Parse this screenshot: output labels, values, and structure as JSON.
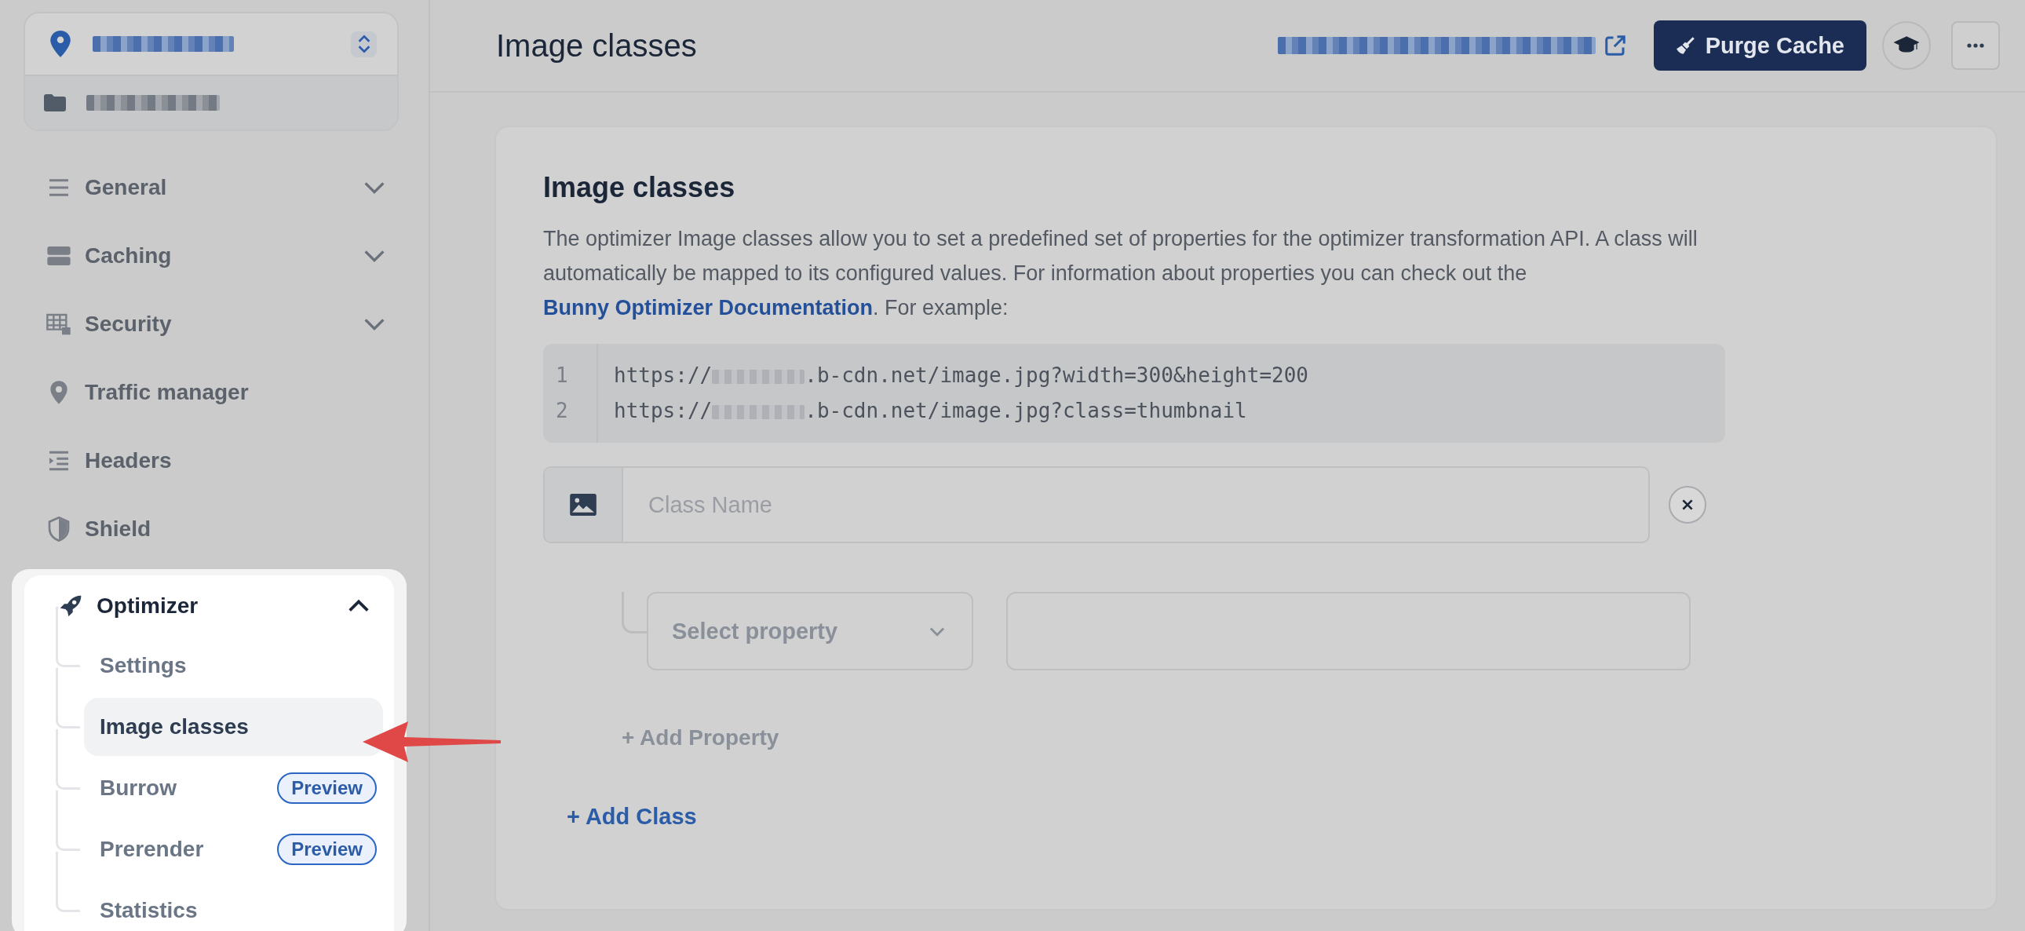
{
  "sidebar": {
    "items": [
      {
        "label": "General",
        "kind": "group",
        "expanded": false
      },
      {
        "label": "Caching",
        "kind": "group",
        "expanded": false
      },
      {
        "label": "Security",
        "kind": "group",
        "expanded": false
      },
      {
        "label": "Traffic manager",
        "kind": "link"
      },
      {
        "label": "Headers",
        "kind": "link"
      },
      {
        "label": "Shield",
        "kind": "link"
      },
      {
        "label": "Optimizer",
        "kind": "group",
        "expanded": true,
        "children": [
          {
            "label": "Settings",
            "selected": false
          },
          {
            "label": "Image classes",
            "selected": true
          },
          {
            "label": "Burrow",
            "selected": false,
            "badge": "Preview"
          },
          {
            "label": "Prerender",
            "selected": false,
            "badge": "Preview"
          },
          {
            "label": "Statistics",
            "selected": false
          }
        ]
      }
    ]
  },
  "header": {
    "title": "Image classes",
    "purge_button": "Purge Cache"
  },
  "card": {
    "title": "Image classes",
    "description_before": "The optimizer Image classes allow you to set a predefined set of properties for the optimizer transformation API. A class will automatically be mapped to its configured values. For information about properties you can check out the ",
    "link": "Bunny Optimizer Documentation",
    "description_after": ". For example:",
    "code_lines": [
      {
        "number": "1",
        "prefix": "https://",
        "suffix": ".b-cdn.net/image.jpg?width=300&height=200"
      },
      {
        "number": "2",
        "prefix": "https://",
        "suffix": ".b-cdn.net/image.jpg?class=thumbnail"
      }
    ],
    "class_name": {
      "placeholder": "Class Name"
    },
    "property_select": {
      "placeholder": "Select property"
    },
    "add_property": "+ Add Property",
    "add_class": "+ Add Class"
  }
}
